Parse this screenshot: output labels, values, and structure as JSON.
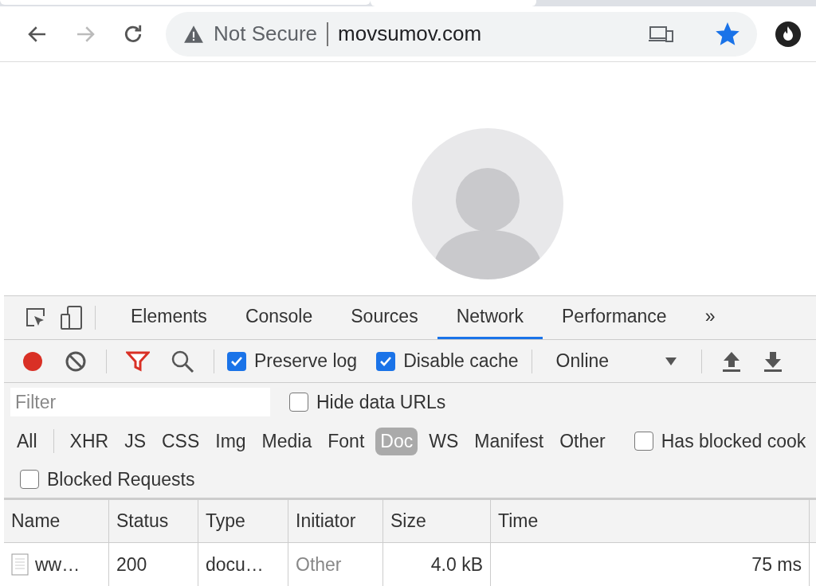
{
  "browser": {
    "security": "Not Secure",
    "url": "movsumov.com",
    "bookmarked": true
  },
  "devtools": {
    "tabs": [
      {
        "label": "Elements",
        "selected": false
      },
      {
        "label": "Console",
        "selected": false
      },
      {
        "label": "Sources",
        "selected": false
      },
      {
        "label": "Network",
        "selected": true
      },
      {
        "label": "Performance",
        "selected": false
      }
    ],
    "more": "»",
    "toolbar": {
      "recording": true,
      "preserve_log": {
        "label": "Preserve log",
        "checked": true
      },
      "disable_cache": {
        "label": "Disable cache",
        "checked": true
      },
      "throttling": "Online"
    },
    "filter": {
      "placeholder": "Filter",
      "hide_data_urls": {
        "label": "Hide data URLs",
        "checked": false
      }
    },
    "types": [
      {
        "label": "All",
        "selected": false
      },
      {
        "label": "XHR",
        "selected": false
      },
      {
        "label": "JS",
        "selected": false
      },
      {
        "label": "CSS",
        "selected": false
      },
      {
        "label": "Img",
        "selected": false
      },
      {
        "label": "Media",
        "selected": false
      },
      {
        "label": "Font",
        "selected": false
      },
      {
        "label": "Doc",
        "selected": true
      },
      {
        "label": "WS",
        "selected": false
      },
      {
        "label": "Manifest",
        "selected": false
      },
      {
        "label": "Other",
        "selected": false
      }
    ],
    "has_blocked_cookies": {
      "label": "Has blocked cook",
      "checked": false
    },
    "blocked_requests": {
      "label": "Blocked Requests",
      "checked": false
    },
    "table": {
      "columns": [
        "Name",
        "Status",
        "Type",
        "Initiator",
        "Size",
        "Time"
      ],
      "rows": [
        {
          "name": "ww…",
          "status": "200",
          "type": "docu…",
          "initiator": "Other",
          "size": "4.0 kB",
          "time": "75 ms"
        }
      ]
    }
  }
}
